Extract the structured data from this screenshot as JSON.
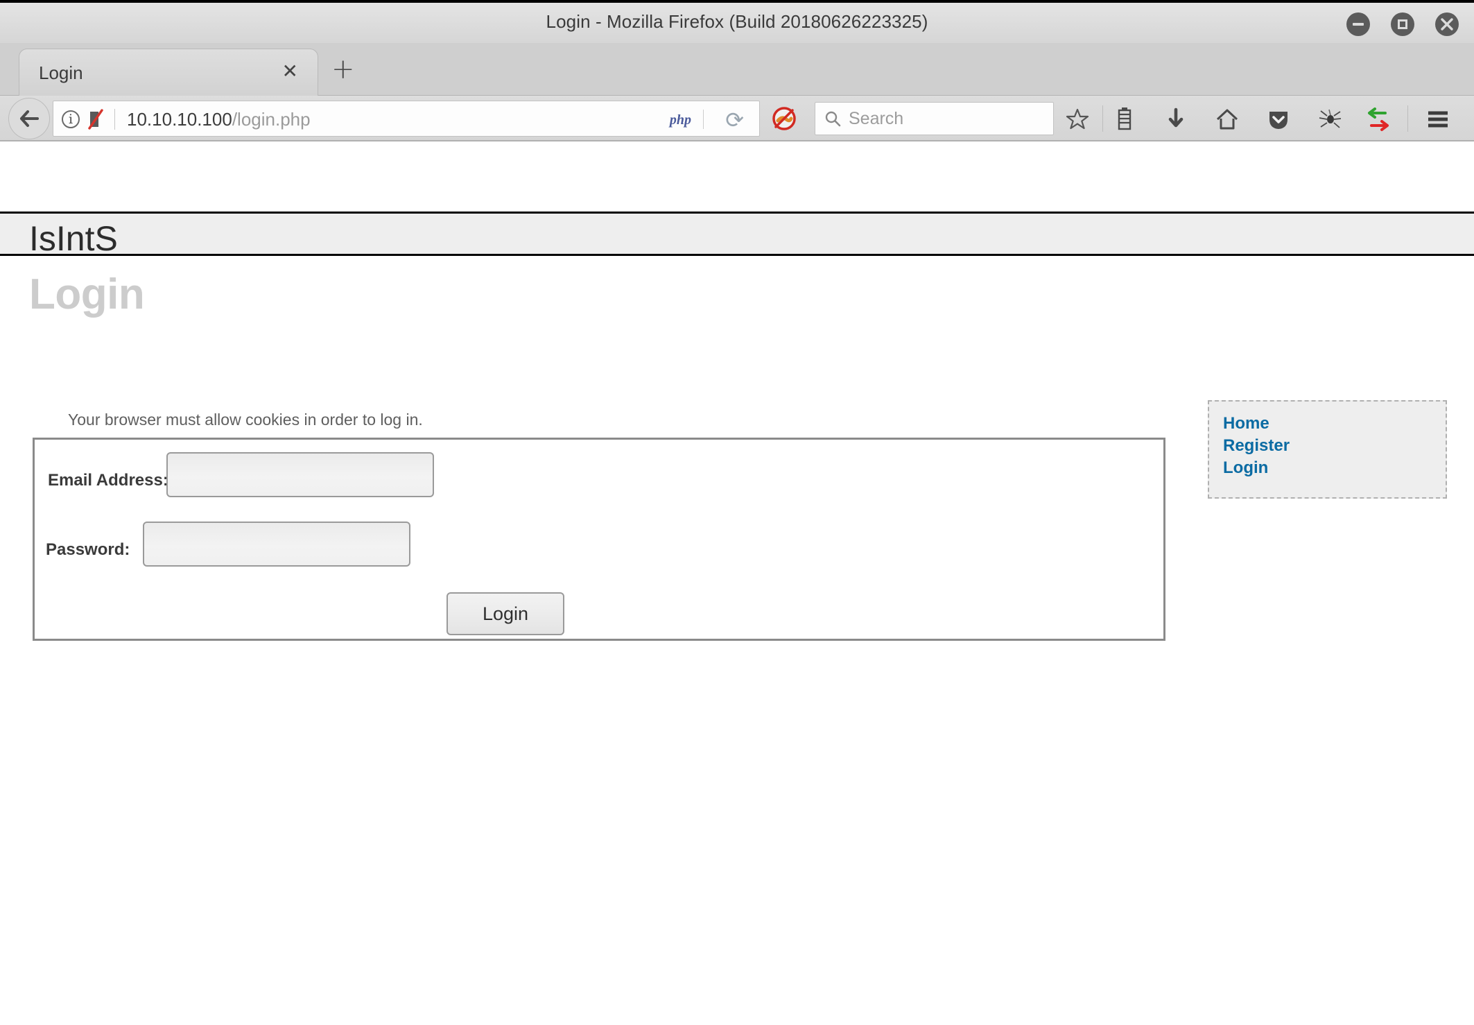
{
  "window": {
    "title": "Login - Mozilla Firefox (Build 20180626223325)",
    "controls": {
      "minimize": "minimize-button",
      "maximize": "maximize-button",
      "close": "close-button"
    }
  },
  "tabs": [
    {
      "label": "Login",
      "close_glyph": "✕"
    }
  ],
  "new_tab_glyph": "+",
  "navbar": {
    "back_glyph": "←",
    "identity_glyph": "i",
    "url_host": "10.10.10.100",
    "url_path": "/login.php",
    "php_badge": "php",
    "reload_glyph": "⟳",
    "search_placeholder": "Search"
  },
  "toolbar_icons": [
    "bookmark-star-icon",
    "library-icon",
    "download-icon",
    "home-icon",
    "pocket-icon",
    "spider-icon",
    "proxy-toggle-icon",
    "menu-icon"
  ],
  "page": {
    "brand": "IsIntS",
    "title": "Login",
    "cookie_note": "Your browser must allow cookies in order to log in.",
    "form": {
      "email_label": "Email Address:",
      "email_value": "",
      "email_placeholder": "",
      "password_label": "Password:",
      "password_value": "",
      "password_placeholder": "",
      "submit_label": "Login"
    },
    "sidebar": {
      "links": [
        {
          "label": "Home"
        },
        {
          "label": "Register"
        },
        {
          "label": "Login"
        }
      ]
    }
  },
  "colors": {
    "link_blue": "#0b6ba3",
    "title_gray": "#cccccc",
    "header_band": "#eeeeee",
    "sidebar_bg": "#eeeeee",
    "field_border": "#9a9a9a"
  }
}
